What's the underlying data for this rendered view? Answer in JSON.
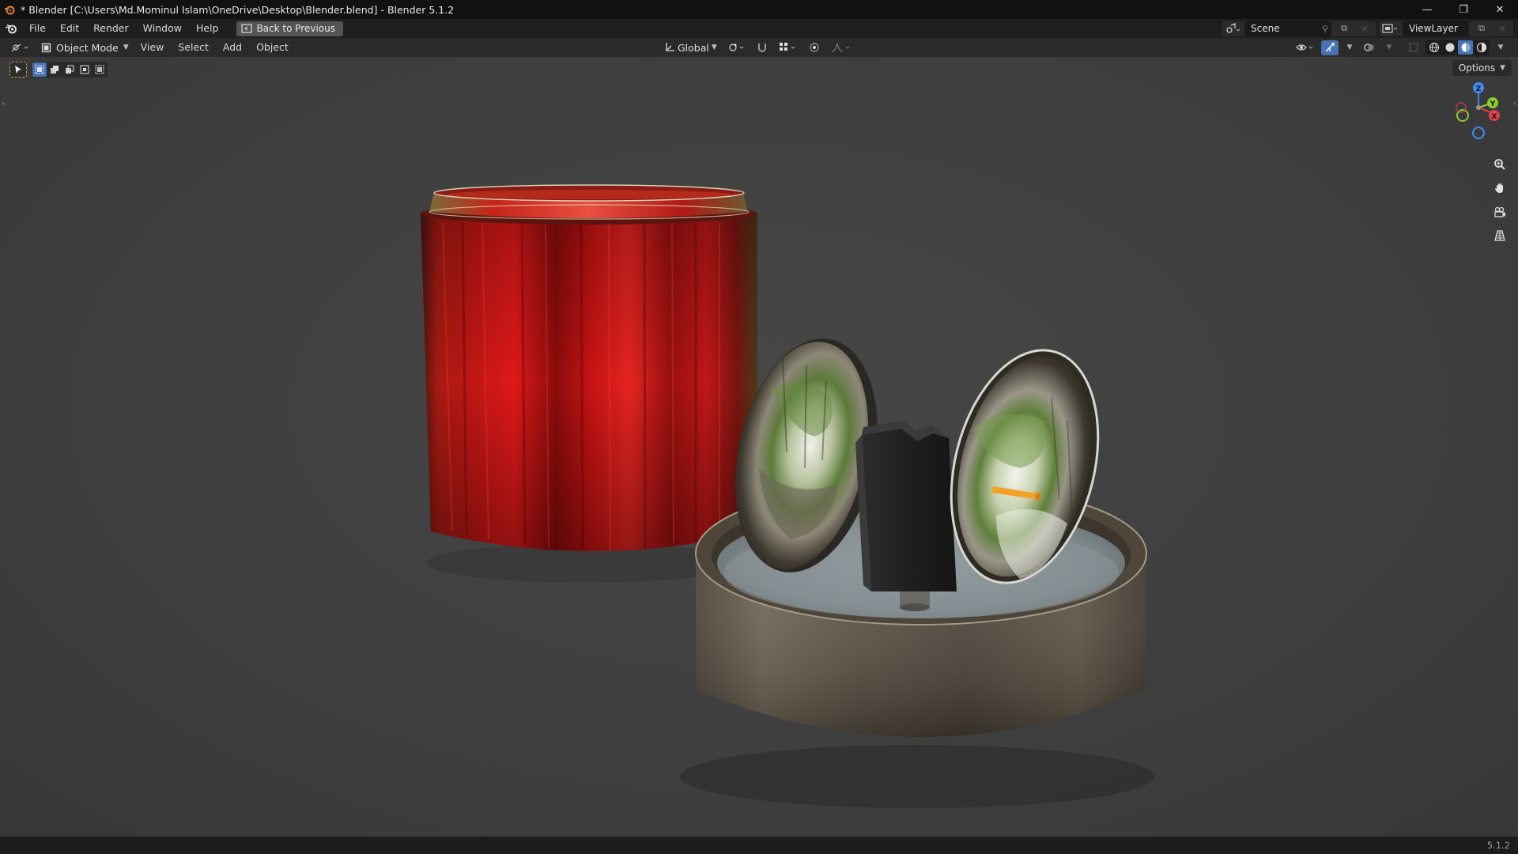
{
  "window": {
    "title": "* Blender [C:\\Users\\Md.Mominul Islam\\OneDrive\\Desktop\\Blender.blend] - Blender 5.1.2",
    "minimize": "—",
    "maximize": "❐",
    "close": "✕"
  },
  "menubar": {
    "items": [
      "File",
      "Edit",
      "Render",
      "Window",
      "Help"
    ],
    "back_label": "Back to Previous",
    "scene_label": "Scene",
    "viewlayer_label": "ViewLayer"
  },
  "viewport_header": {
    "mode": "Object Mode",
    "menus": [
      "View",
      "Select",
      "Add",
      "Object"
    ],
    "transform_orientation": "Global"
  },
  "viewport": {
    "options_label": "Options",
    "gizmo": {
      "z_label": "Z",
      "x_label": "X",
      "y_label": "Y",
      "colors": {
        "x": "#e43f4f",
        "y": "#8ecb2d",
        "z": "#3f8bf0"
      }
    }
  },
  "statusbar": {
    "version": "5.1.2"
  },
  "colors": {
    "accent": "#4772b3",
    "background": "#1d1d1d",
    "viewport": "#404040"
  }
}
